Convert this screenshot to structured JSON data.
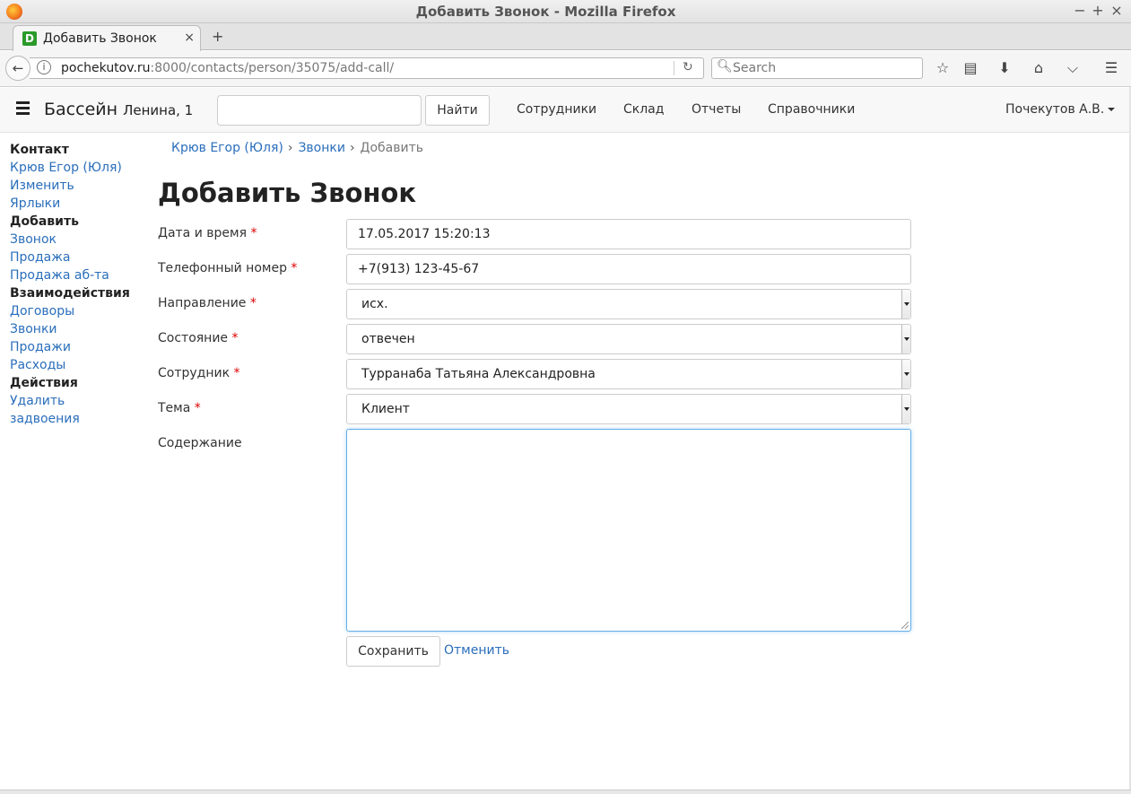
{
  "window": {
    "title": "Добавить Звонок - Mozilla Firefox",
    "minimize_glyph": "−",
    "maximize_glyph": "+",
    "close_glyph": "×"
  },
  "tab": {
    "favicon_letter": "D",
    "label": "Добавить Звонок",
    "close_glyph": "×",
    "new_tab_glyph": "+"
  },
  "navbar": {
    "url_host": "pochekutov.ru",
    "url_path": ":8000/contacts/person/35075/add-call/",
    "search_placeholder": "Search"
  },
  "header": {
    "brand": "Бассейн",
    "brand_sub": "Ленина, 1",
    "search_value": "",
    "find_button": "Найти",
    "nav": [
      "Сотрудники",
      "Склад",
      "Отчеты",
      "Справочники"
    ],
    "user": "Почекутов А.В."
  },
  "sidebar": {
    "items": [
      {
        "label": "Контакт",
        "type": "head"
      },
      {
        "label": "Крюв Егор (Юля)",
        "type": "link"
      },
      {
        "label": "Изменить",
        "type": "link"
      },
      {
        "label": "Ярлыки",
        "type": "link"
      },
      {
        "label": "Добавить",
        "type": "head"
      },
      {
        "label": "Звонок",
        "type": "link"
      },
      {
        "label": "Продажа",
        "type": "link"
      },
      {
        "label": "Продажа аб-та",
        "type": "link"
      },
      {
        "label": "Взаимодействия",
        "type": "head"
      },
      {
        "label": "Договоры",
        "type": "link"
      },
      {
        "label": "Звонки",
        "type": "link"
      },
      {
        "label": "Продажи",
        "type": "link"
      },
      {
        "label": "Расходы",
        "type": "link"
      },
      {
        "label": "Действия",
        "type": "head"
      },
      {
        "label": "Удалить",
        "type": "link"
      },
      {
        "label": "задвоения",
        "type": "link"
      }
    ]
  },
  "breadcrumb": {
    "items": [
      "Крюв Егор (Юля)",
      "Звонки"
    ],
    "separator": "›",
    "active": "Добавить"
  },
  "page": {
    "title": "Добавить Звонок"
  },
  "form": {
    "required_mark": "*",
    "datetime": {
      "label": "Дата и время",
      "value": "17.05.2017 15:20:13"
    },
    "phone": {
      "label": "Телефонный номер",
      "value": "+7(913) 123-45-67"
    },
    "direction": {
      "label": "Направление",
      "value": "исх."
    },
    "status": {
      "label": "Состояние",
      "value": "отвечен"
    },
    "employee": {
      "label": "Сотрудник",
      "value": "Турранаба Татьяна Александровна"
    },
    "topic": {
      "label": "Тема",
      "value": "Клиент"
    },
    "content": {
      "label": "Содержание",
      "value": ""
    },
    "save_button": "Сохранить",
    "cancel_link": "Отменить"
  },
  "colors": {
    "link": "#2a6ebb",
    "required": "#dd0000",
    "focus_border": "#66afe9"
  }
}
